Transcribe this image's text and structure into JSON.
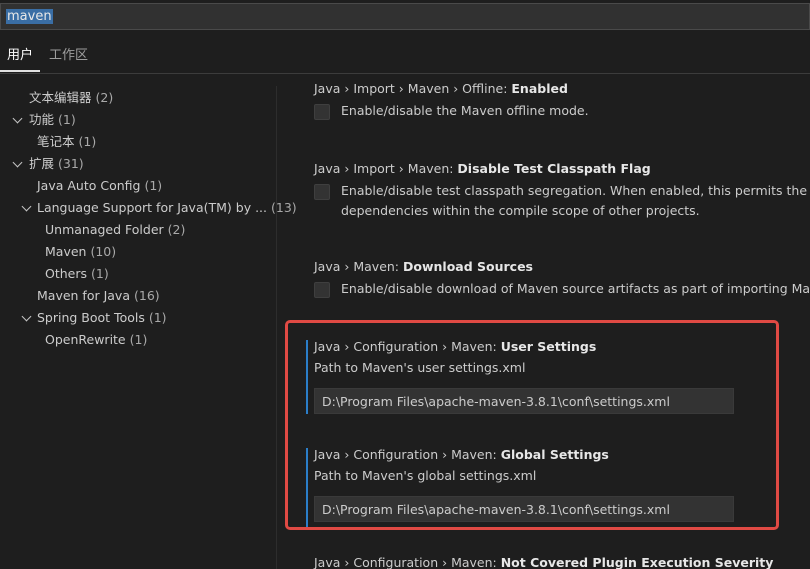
{
  "search": {
    "value": "maven"
  },
  "tabs": [
    {
      "label": "用户"
    },
    {
      "label": "工作区"
    }
  ],
  "toc": [
    {
      "label": "文本编辑器",
      "count": "(2)"
    },
    {
      "label": "功能",
      "count": "(1)"
    },
    {
      "label": "笔记本",
      "count": "(1)"
    },
    {
      "label": "扩展",
      "count": "(31)"
    },
    {
      "label": "Java Auto Config",
      "count": "(1)"
    },
    {
      "label": "Language Support for Java(TM) by ...",
      "count": "(13)"
    },
    {
      "label": "Unmanaged Folder",
      "count": "(2)"
    },
    {
      "label": "Maven",
      "count": "(10)"
    },
    {
      "label": "Others",
      "count": "(1)"
    },
    {
      "label": "Maven for Java",
      "count": "(16)"
    },
    {
      "label": "Spring Boot Tools",
      "count": "(1)"
    },
    {
      "label": "OpenRewrite",
      "count": "(1)"
    }
  ],
  "settings": [
    {
      "prefix": "Java › Import › Maven › Offline: ",
      "name": "Enabled",
      "desc": [
        "Enable/disable the Maven offline mode."
      ]
    },
    {
      "prefix": "Java › Import › Maven: ",
      "name": "Disable Test Classpath Flag",
      "desc": [
        "Enable/disable test classpath segregation. When enabled, this permits the usage o",
        "dependencies within the compile scope of other projects."
      ]
    },
    {
      "prefix": "Java › Maven: ",
      "name": "Download Sources",
      "desc": [
        "Enable/disable download of Maven source artifacts as part of importing Maven pr"
      ]
    },
    {
      "prefix": "Java › Configuration › Maven: ",
      "name": "User Settings",
      "desc": [
        "Path to Maven's user settings.xml"
      ],
      "value": "D:\\Program Files\\apache-maven-3.8.1\\conf\\settings.xml"
    },
    {
      "prefix": "Java › Configuration › Maven: ",
      "name": "Global Settings",
      "desc": [
        "Path to Maven's global settings.xml"
      ],
      "value": "D:\\Program Files\\apache-maven-3.8.1\\conf\\settings.xml"
    },
    {
      "prefix": "Java › Configuration › Maven: ",
      "name": "Not Covered Plugin Execution Severity"
    }
  ],
  "colors": {
    "accent_focus": "#2b7ec9",
    "annotation_box": "#e04a44"
  }
}
